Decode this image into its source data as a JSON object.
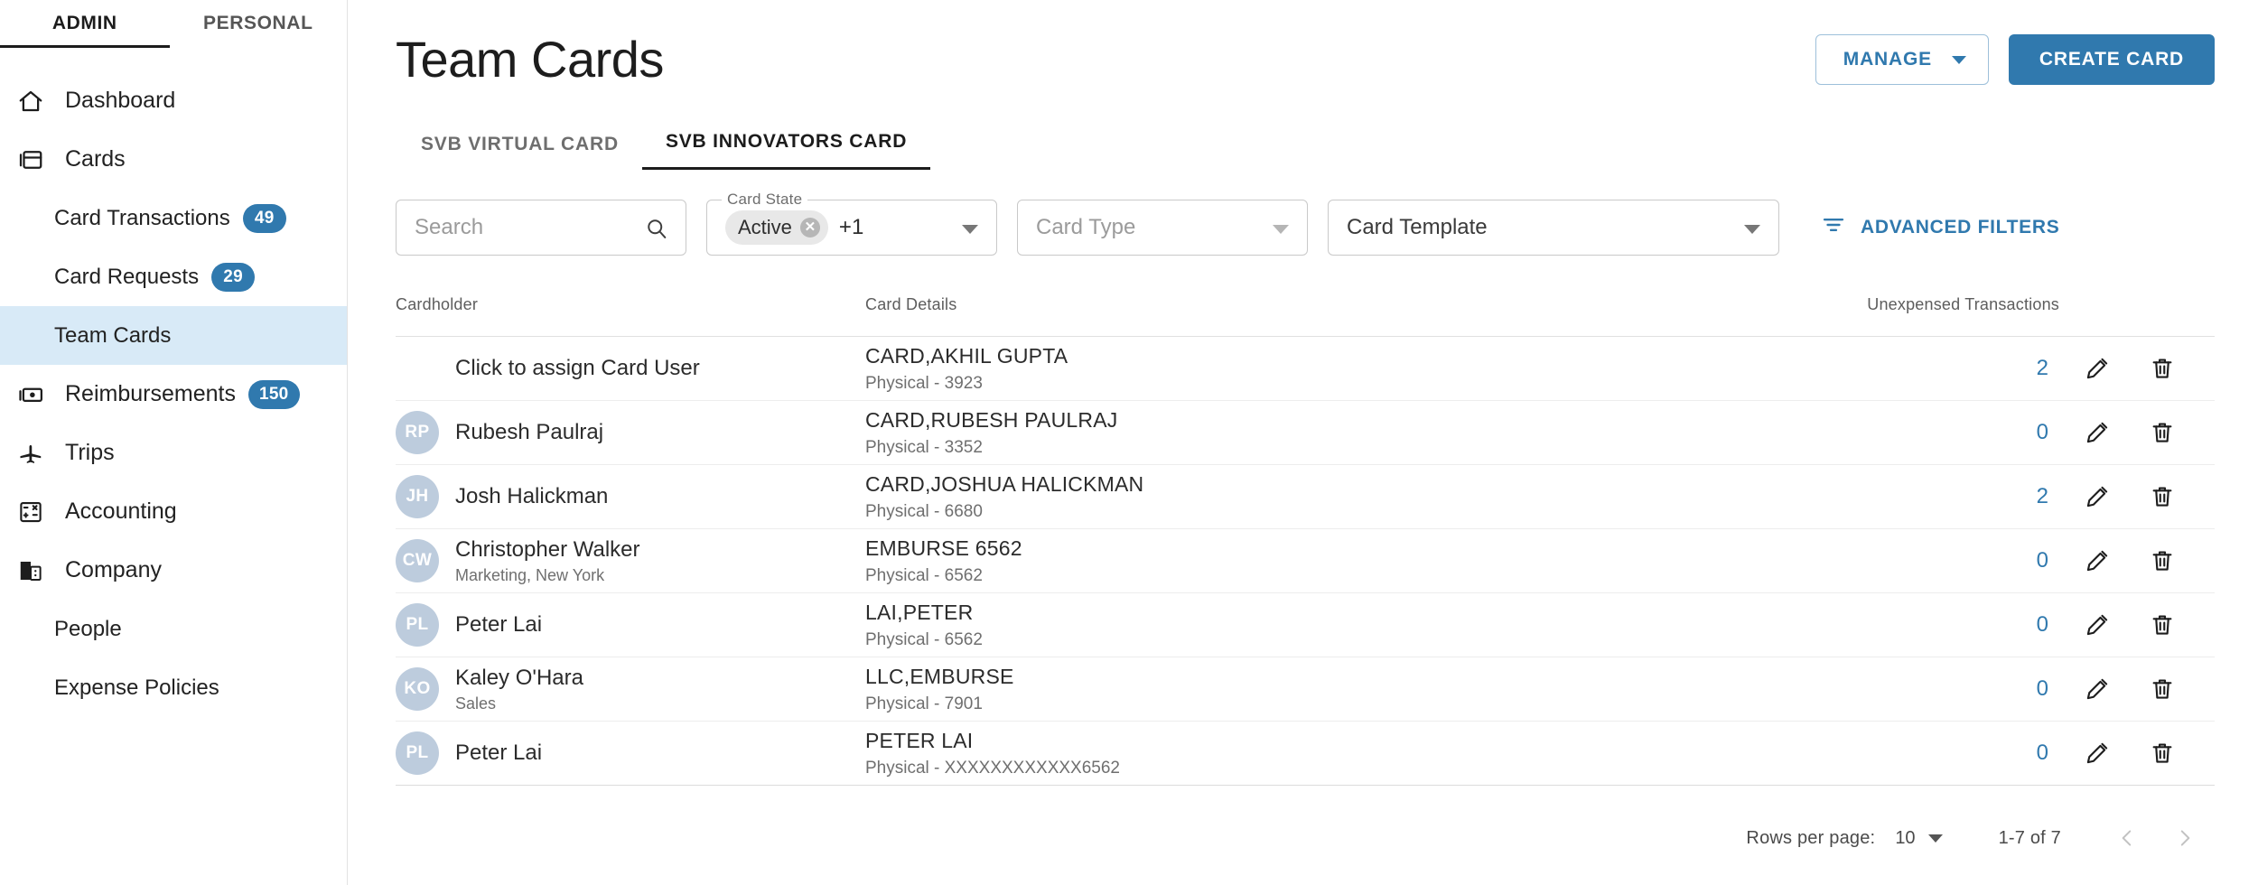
{
  "sidebar": {
    "scope_tabs": [
      {
        "label": "ADMIN",
        "active": true
      },
      {
        "label": "PERSONAL",
        "active": false
      }
    ],
    "items": [
      {
        "label": "Dashboard",
        "icon": "home-icon",
        "badge": "",
        "sub": false,
        "active": false
      },
      {
        "label": "Cards",
        "icon": "cards-icon",
        "badge": "",
        "sub": false,
        "active": false
      },
      {
        "label": "Card Transactions",
        "icon": "",
        "badge": "49",
        "sub": true,
        "active": false
      },
      {
        "label": "Card Requests",
        "icon": "",
        "badge": "29",
        "sub": true,
        "active": false
      },
      {
        "label": "Team Cards",
        "icon": "",
        "badge": "",
        "sub": true,
        "active": true
      },
      {
        "label": "Reimbursements",
        "icon": "money-icon",
        "badge": "150",
        "sub": false,
        "active": false
      },
      {
        "label": "Trips",
        "icon": "plane-icon",
        "badge": "",
        "sub": false,
        "active": false
      },
      {
        "label": "Accounting",
        "icon": "calculator-icon",
        "badge": "",
        "sub": false,
        "active": false
      },
      {
        "label": "Company",
        "icon": "building-icon",
        "badge": "",
        "sub": false,
        "active": false
      },
      {
        "label": "People",
        "icon": "",
        "badge": "",
        "sub": true,
        "active": false
      },
      {
        "label": "Expense Policies",
        "icon": "",
        "badge": "",
        "sub": true,
        "active": false
      }
    ]
  },
  "header": {
    "title": "Team Cards",
    "manage_label": "MANAGE",
    "create_label": "CREATE CARD"
  },
  "tabs": [
    {
      "label": "SVB VIRTUAL CARD",
      "active": false
    },
    {
      "label": "SVB INNOVATORS CARD",
      "active": true
    }
  ],
  "filters": {
    "search_placeholder": "Search",
    "search_value": "",
    "card_state_legend": "Card State",
    "card_state_chip": "Active",
    "card_state_extra": "+1",
    "card_type_placeholder": "Card Type",
    "card_template_value": "Card Template",
    "advanced_filters_label": "ADVANCED FILTERS"
  },
  "table": {
    "columns": {
      "cardholder": "Cardholder",
      "card_details": "Card Details",
      "unexpensed": "Unexpensed Transactions"
    },
    "rows": [
      {
        "initials": "",
        "name": "Click to assign Card User",
        "subtitle": "",
        "assign": true,
        "card_title": "CARD,AKHIL GUPTA",
        "card_meta": "Physical - 3923",
        "unexpensed": "2"
      },
      {
        "initials": "RP",
        "name": "Rubesh Paulraj",
        "subtitle": "",
        "assign": false,
        "card_title": "CARD,RUBESH PAULRAJ",
        "card_meta": "Physical - 3352",
        "unexpensed": "0"
      },
      {
        "initials": "JH",
        "name": "Josh Halickman",
        "subtitle": "",
        "assign": false,
        "card_title": "CARD,JOSHUA HALICKMAN",
        "card_meta": "Physical - 6680",
        "unexpensed": "2"
      },
      {
        "initials": "CW",
        "name": "Christopher Walker",
        "subtitle": "Marketing, New York",
        "assign": false,
        "card_title": "EMBURSE 6562",
        "card_meta": "Physical - 6562",
        "unexpensed": "0"
      },
      {
        "initials": "PL",
        "name": "Peter Lai",
        "subtitle": "",
        "assign": false,
        "card_title": "LAI,PETER",
        "card_meta": "Physical - 6562",
        "unexpensed": "0"
      },
      {
        "initials": "KO",
        "name": "Kaley O'Hara",
        "subtitle": "Sales",
        "assign": false,
        "card_title": "LLC,EMBURSE",
        "card_meta": "Physical - 7901",
        "unexpensed": "0"
      },
      {
        "initials": "PL",
        "name": "Peter Lai",
        "subtitle": "",
        "assign": false,
        "card_title": "PETER LAI",
        "card_meta": "Physical - XXXXXXXXXXXX6562",
        "unexpensed": "0"
      }
    ]
  },
  "pagination": {
    "rows_per_page_label": "Rows per page:",
    "rows_per_page_value": "10",
    "range": "1-7 of 7"
  },
  "colors": {
    "accent_blue": "#3079ae",
    "active_nav_bg": "#d8eaf7",
    "avatar_bg": "#bdccdd",
    "badge_bg": "#3079ae"
  }
}
